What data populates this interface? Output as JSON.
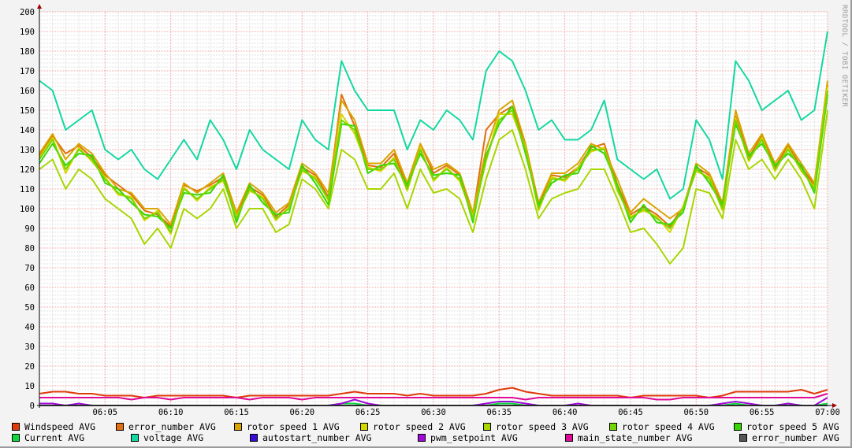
{
  "watermark": "RRDTOOL / TOBI OETIKER",
  "chart_data": {
    "type": "line",
    "title": "",
    "xlabel": "",
    "ylabel": "",
    "ylim": [
      0,
      200
    ],
    "yticks": [
      "0",
      "10",
      "20",
      "30",
      "40",
      "50",
      "60",
      "70",
      "80",
      "90",
      "100",
      "110",
      "120",
      "130",
      "140",
      "150",
      "160",
      "170",
      "180",
      "190",
      "200"
    ],
    "xticks": [
      "06:05",
      "06:10",
      "06:15",
      "06:20",
      "06:25",
      "06:30",
      "06:35",
      "06:40",
      "06:45",
      "06:50",
      "06:55",
      "07:00"
    ],
    "x_range_minutes": [
      0,
      60
    ],
    "grid": true,
    "legend_placement": "bottom",
    "series": [
      {
        "name": "Windspeed AVG",
        "color": "#e03a0b",
        "values": [
          6,
          7,
          7,
          6,
          6,
          5,
          5,
          5,
          4,
          5,
          5,
          5,
          5,
          5,
          5,
          4,
          5,
          5,
          5,
          5,
          5,
          5,
          5,
          6,
          7,
          6,
          6,
          6,
          5,
          6,
          5,
          5,
          5,
          5,
          6,
          8,
          9,
          7,
          6,
          5,
          5,
          5,
          5,
          5,
          5,
          4,
          5,
          5,
          5,
          5,
          5,
          4,
          5,
          7,
          7,
          7,
          7,
          7,
          8,
          6,
          8
        ]
      },
      {
        "name": "error_number AVG",
        "color": "#e07010",
        "values": [
          127,
          137,
          128,
          132,
          126,
          117,
          112,
          107,
          99,
          97,
          91,
          112,
          109,
          112,
          116,
          97,
          111,
          107,
          96,
          102,
          121,
          117,
          106,
          158,
          142,
          122,
          121,
          128,
          111,
          133,
          118,
          122,
          117,
          97,
          140,
          148,
          152,
          132,
          101,
          117,
          116,
          121,
          131,
          133,
          112,
          97,
          101,
          97,
          91,
          101,
          121,
          117,
          101,
          147,
          126,
          137,
          121,
          132,
          121,
          112,
          163
        ]
      },
      {
        "name": "rotor speed 1 AVG",
        "color": "#d9a400",
        "values": [
          128,
          138,
          125,
          133,
          128,
          118,
          110,
          108,
          100,
          100,
          92,
          113,
          108,
          113,
          118,
          98,
          113,
          108,
          98,
          103,
          123,
          118,
          108,
          155,
          145,
          123,
          123,
          130,
          113,
          133,
          120,
          123,
          118,
          98,
          130,
          150,
          155,
          133,
          103,
          118,
          118,
          123,
          133,
          130,
          115,
          98,
          105,
          100,
          95,
          100,
          123,
          118,
          103,
          150,
          128,
          138,
          123,
          133,
          123,
          113,
          165
        ]
      },
      {
        "name": "rotor speed 2 AVG",
        "color": "#d6d600",
        "values": [
          126,
          136,
          118,
          131,
          124,
          116,
          107,
          106,
          94,
          99,
          87,
          111,
          104,
          111,
          114,
          96,
          109,
          106,
          94,
          101,
          119,
          116,
          104,
          148,
          138,
          121,
          119,
          126,
          109,
          131,
          114,
          121,
          114,
          96,
          124,
          148,
          148,
          131,
          99,
          116,
          114,
          121,
          129,
          131,
          109,
          96,
          99,
          96,
          88,
          101,
          119,
          116,
          99,
          146,
          124,
          136,
          119,
          131,
          119,
          111,
          162
        ]
      },
      {
        "name": "rotor speed 3 AVG",
        "color": "#a8d600",
        "values": [
          120,
          125,
          110,
          120,
          115,
          105,
          100,
          95,
          82,
          90,
          80,
          100,
          95,
          100,
          110,
          90,
          100,
          100,
          88,
          92,
          115,
          110,
          100,
          130,
          125,
          110,
          110,
          118,
          100,
          120,
          108,
          110,
          105,
          88,
          115,
          135,
          140,
          120,
          95,
          105,
          108,
          110,
          120,
          120,
          105,
          88,
          90,
          82,
          72,
          80,
          110,
          108,
          95,
          135,
          120,
          125,
          115,
          125,
          115,
          100,
          150
        ]
      },
      {
        "name": "rotor speed 4 AVG",
        "color": "#74d600",
        "values": [
          125,
          135,
          120,
          130,
          125,
          115,
          108,
          105,
          95,
          98,
          88,
          110,
          105,
          110,
          115,
          95,
          110,
          105,
          95,
          100,
          120,
          115,
          105,
          145,
          140,
          120,
          120,
          125,
          110,
          130,
          115,
          120,
          115,
          95,
          125,
          145,
          150,
          130,
          100,
          115,
          115,
          120,
          130,
          130,
          110,
          95,
          100,
          95,
          90,
          100,
          120,
          115,
          100,
          145,
          125,
          135,
          120,
          130,
          120,
          110,
          160
        ]
      },
      {
        "name": "rotor speed 5 AVG",
        "color": "#36d600",
        "values": [
          123,
          133,
          122,
          128,
          127,
          113,
          110,
          103,
          97,
          96,
          90,
          108,
          107,
          108,
          117,
          93,
          112,
          103,
          97,
          98,
          122,
          113,
          102,
          143,
          142,
          118,
          122,
          123,
          112,
          128,
          117,
          118,
          117,
          93,
          127,
          143,
          152,
          128,
          102,
          113,
          117,
          118,
          132,
          128,
          112,
          93,
          102,
          93,
          92,
          98,
          122,
          113,
          102,
          143,
          127,
          133,
          122,
          128,
          122,
          108,
          158
        ]
      },
      {
        "name": "Current AVG",
        "color": "#0ed840",
        "values": [
          0,
          0,
          0,
          0,
          0,
          0,
          0,
          0,
          0,
          0,
          0,
          0,
          0,
          0,
          0,
          0,
          0,
          0,
          0,
          0,
          0,
          0,
          0,
          1,
          1,
          0,
          0,
          0,
          0,
          0,
          0,
          0,
          0,
          0,
          0,
          1,
          1,
          0,
          0,
          0,
          0,
          0,
          0,
          0,
          0,
          0,
          0,
          0,
          0,
          0,
          0,
          0,
          0,
          1,
          0,
          0,
          0,
          1,
          0,
          0,
          1
        ]
      },
      {
        "name": "voltage AVG",
        "color": "#12d8a0",
        "values": [
          165,
          160,
          140,
          145,
          150,
          130,
          125,
          130,
          120,
          115,
          125,
          135,
          125,
          145,
          135,
          120,
          140,
          130,
          125,
          120,
          145,
          135,
          130,
          175,
          160,
          150,
          150,
          150,
          130,
          145,
          140,
          150,
          145,
          135,
          170,
          180,
          175,
          160,
          140,
          145,
          135,
          135,
          140,
          155,
          125,
          120,
          115,
          120,
          105,
          110,
          145,
          135,
          115,
          175,
          165,
          150,
          155,
          160,
          145,
          150,
          190
        ]
      },
      {
        "name": "autostart_number AVG",
        "color": "#3a0ad8",
        "values": [
          0,
          0,
          0,
          0,
          0,
          0,
          0,
          0,
          0,
          0,
          0,
          0,
          0,
          0,
          0,
          0,
          0,
          0,
          0,
          0,
          0,
          0,
          0,
          0,
          0,
          0,
          0,
          0,
          0,
          0,
          0,
          0,
          0,
          0,
          0,
          0,
          0,
          0,
          0,
          0,
          0,
          0,
          0,
          0,
          0,
          0,
          0,
          0,
          0,
          0,
          0,
          0,
          0,
          0,
          0,
          0,
          0,
          0,
          0,
          0,
          0
        ]
      },
      {
        "name": "pwm_setpoint AVG",
        "color": "#a00ad8",
        "values": [
          1,
          1,
          0,
          1,
          0,
          0,
          0,
          0,
          0,
          0,
          0,
          0,
          0,
          0,
          0,
          0,
          0,
          0,
          0,
          0,
          0,
          0,
          0,
          1,
          3,
          1,
          0,
          0,
          0,
          0,
          0,
          0,
          0,
          0,
          1,
          2,
          2,
          1,
          0,
          0,
          0,
          1,
          0,
          0,
          0,
          0,
          0,
          0,
          0,
          0,
          0,
          0,
          1,
          2,
          1,
          0,
          0,
          1,
          0,
          0,
          4
        ]
      },
      {
        "name": "main_state_number AVG",
        "color": "#e00a98",
        "values": [
          4,
          4,
          4,
          4,
          4,
          4,
          4,
          3,
          4,
          4,
          3,
          4,
          4,
          4,
          4,
          4,
          3,
          4,
          4,
          4,
          3,
          4,
          4,
          4,
          4,
          4,
          4,
          4,
          4,
          4,
          4,
          4,
          4,
          4,
          4,
          4,
          4,
          3,
          4,
          4,
          4,
          4,
          4,
          4,
          4,
          4,
          4,
          3,
          3,
          4,
          4,
          4,
          4,
          4,
          4,
          4,
          4,
          4,
          4,
          4,
          6
        ]
      },
      {
        "name": "error_number AVG",
        "color": "#555555",
        "values": [
          0,
          0,
          0,
          0,
          0,
          0,
          0,
          0,
          0,
          0,
          0,
          0,
          0,
          0,
          0,
          0,
          0,
          0,
          0,
          0,
          0,
          0,
          0,
          0,
          0,
          0,
          0,
          0,
          0,
          0,
          0,
          0,
          0,
          0,
          0,
          0,
          0,
          0,
          0,
          0,
          0,
          0,
          0,
          0,
          0,
          0,
          0,
          0,
          0,
          0,
          0,
          0,
          0,
          0,
          0,
          0,
          0,
          0,
          0,
          0,
          0
        ]
      }
    ]
  }
}
